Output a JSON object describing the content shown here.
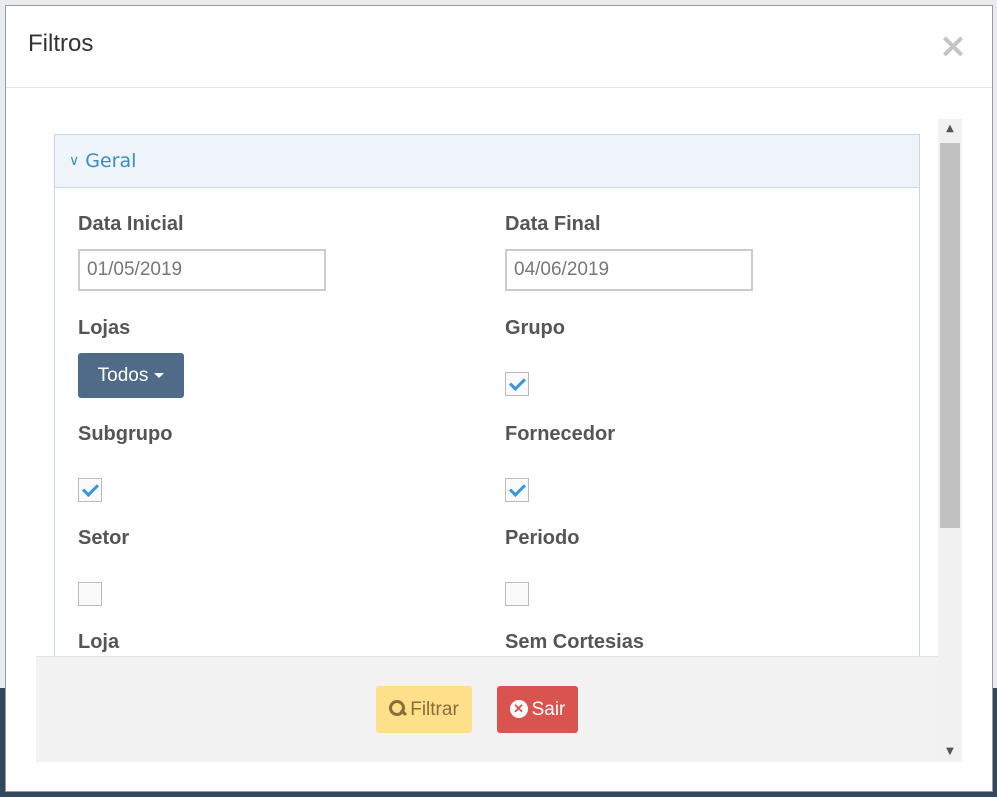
{
  "modal": {
    "title": "Filtros",
    "close_symbol": "×"
  },
  "panel": {
    "heading": "Geral",
    "chevron": "⌄"
  },
  "fields": {
    "data_inicial": {
      "label": "Data Inicial",
      "value": "01/05/2019"
    },
    "data_final": {
      "label": "Data Final",
      "value": "04/06/2019"
    },
    "lojas": {
      "label": "Lojas",
      "button": "Todos"
    },
    "grupo": {
      "label": "Grupo",
      "checked": true
    },
    "subgrupo": {
      "label": "Subgrupo",
      "checked": true
    },
    "fornecedor": {
      "label": "Fornecedor",
      "checked": true
    },
    "setor": {
      "label": "Setor",
      "checked": false
    },
    "periodo": {
      "label": "Periodo",
      "checked": false
    },
    "loja": {
      "label": "Loja"
    },
    "sem_cortesias": {
      "label": "Sem Cortesias"
    }
  },
  "footer": {
    "filter_label": "Filtrar",
    "exit_label": "Sair"
  },
  "colors": {
    "accent": "#3b8dbd",
    "dropdown_bg": "#4f6b87",
    "filter_bg": "#ffe08a",
    "exit_bg": "#d9534f"
  },
  "icons": {
    "close": "close-icon",
    "chevron": "chevron-down-icon",
    "search": "search-icon",
    "exit": "x-circle-icon"
  }
}
